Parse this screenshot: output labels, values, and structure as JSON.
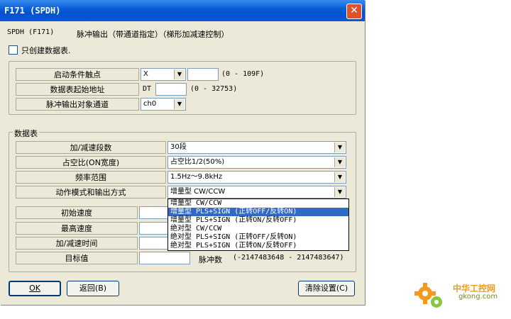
{
  "window": {
    "title": "F171 (SPDH)",
    "close_glyph": "✕"
  },
  "header": {
    "code": "SPDH (F171)",
    "description": "脉冲输出（带通道指定）（梯形加减速控制）"
  },
  "only_create_table": {
    "label": "只创建数据表.",
    "checked": false
  },
  "group1": {
    "start_contact": {
      "label": "启动条件触点",
      "device": "X",
      "number": "",
      "range": "(0 - 109F)"
    },
    "table_start": {
      "label": "数据表起始地址",
      "prefix": "DT",
      "value": "",
      "range": "(0 - 32753)"
    },
    "channel": {
      "label": "脉冲输出对象通道",
      "value": "ch0"
    }
  },
  "group2": {
    "title": "数据表",
    "accel_steps": {
      "label": "加/减速段数",
      "value": "30段"
    },
    "duty": {
      "label": "占空比(ON宽度)",
      "value": "占空比1/2(50%)"
    },
    "freq": {
      "label": "频率范围",
      "value": "1.5Hz～9.8kHz"
    },
    "mode": {
      "label": "动作模式和输出方式",
      "value": "增量型  CW/CCW"
    },
    "init_speed": {
      "label": "初始速度",
      "value": ""
    },
    "max_speed": {
      "label": "最高速度",
      "value": ""
    },
    "accel_time": {
      "label": "加/减速时间",
      "value": ""
    },
    "target": {
      "label": "目标值",
      "value": "",
      "unit": "脉冲数",
      "range": "(-2147483648 - 2147483647)"
    }
  },
  "mode_dropdown": {
    "options": [
      "增量型  CW/CCW",
      "增量型  PLS+SIGN (正转OFF/反转ON)",
      "增量型  PLS+SIGN (正转ON/反转OFF)",
      "绝对型  CW/CCW",
      "绝对型  PLS+SIGN (正转OFF/反转ON)",
      "绝对型  PLS+SIGN (正转ON/反转OFF)"
    ],
    "highlighted_index": 1
  },
  "buttons": {
    "ok": "OK",
    "back": "返回(B)",
    "clear": "清除设置(C)"
  },
  "watermark": {
    "line1": "中华工控网",
    "line2": "gkong.com"
  },
  "icons": {
    "dropdown": "▼"
  },
  "colors": {
    "title_bar": "#0a5fd8",
    "highlight": "#316ac5",
    "watermark_orange": "#f29a1d"
  }
}
